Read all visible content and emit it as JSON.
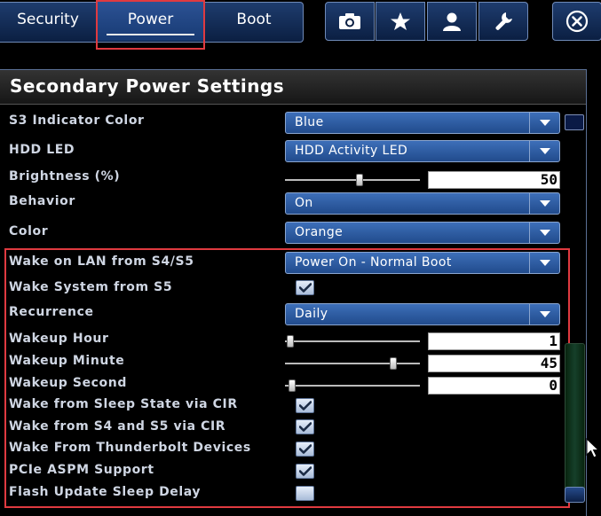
{
  "tabs": [
    {
      "label": "Security",
      "active": false
    },
    {
      "label": "Power",
      "active": true
    },
    {
      "label": "Boot",
      "active": false
    }
  ],
  "toolbar_icons": [
    "camera-icon",
    "star-icon",
    "user-icon",
    "wrench-icon"
  ],
  "close_icon": "close-circle-icon",
  "panel": {
    "title": "Secondary Power Settings",
    "s3_indicator_color": {
      "label": "S3 Indicator Color",
      "value": "Blue",
      "swatch_color": "#0a1a46"
    },
    "hdd_led": {
      "label": "HDD LED",
      "value": "HDD Activity LED"
    },
    "brightness": {
      "label": "Brightness (%)",
      "value": "50",
      "slider_fraction": 0.55
    },
    "behavior": {
      "label": "Behavior",
      "value": "On"
    },
    "color": {
      "label": "Color",
      "value": "Orange"
    },
    "wake_on_lan": {
      "label": "Wake on LAN from S4/S5",
      "value": "Power On - Normal Boot"
    },
    "wake_system_s5": {
      "label": "Wake System from S5",
      "checked": true
    },
    "recurrence": {
      "label": "Recurrence",
      "value": "Daily"
    },
    "wakeup_hour": {
      "label": "Wakeup Hour",
      "value": "1",
      "slider_fraction": 0.04
    },
    "wakeup_minute": {
      "label": "Wakeup Minute",
      "value": "45",
      "slider_fraction": 0.8
    },
    "wakeup_second": {
      "label": "Wakeup Second",
      "value": "0",
      "slider_fraction": 0.05
    },
    "wake_sleep_cir": {
      "label": "Wake from Sleep State via CIR",
      "checked": true
    },
    "wake_s4_s5_cir": {
      "label": "Wake from S4 and S5 via CIR",
      "checked": true
    },
    "wake_thunderbolt": {
      "label": "Wake From Thunderbolt Devices",
      "checked": true
    },
    "pcie_aspm": {
      "label": "PCIe ASPM Support",
      "checked": true
    },
    "flash_update_delay": {
      "label": "Flash Update Sleep Delay",
      "checked": false
    }
  },
  "colors": {
    "accent_blue": "#2c5294",
    "highlight_red": "#e03a40",
    "background": "#000000"
  }
}
